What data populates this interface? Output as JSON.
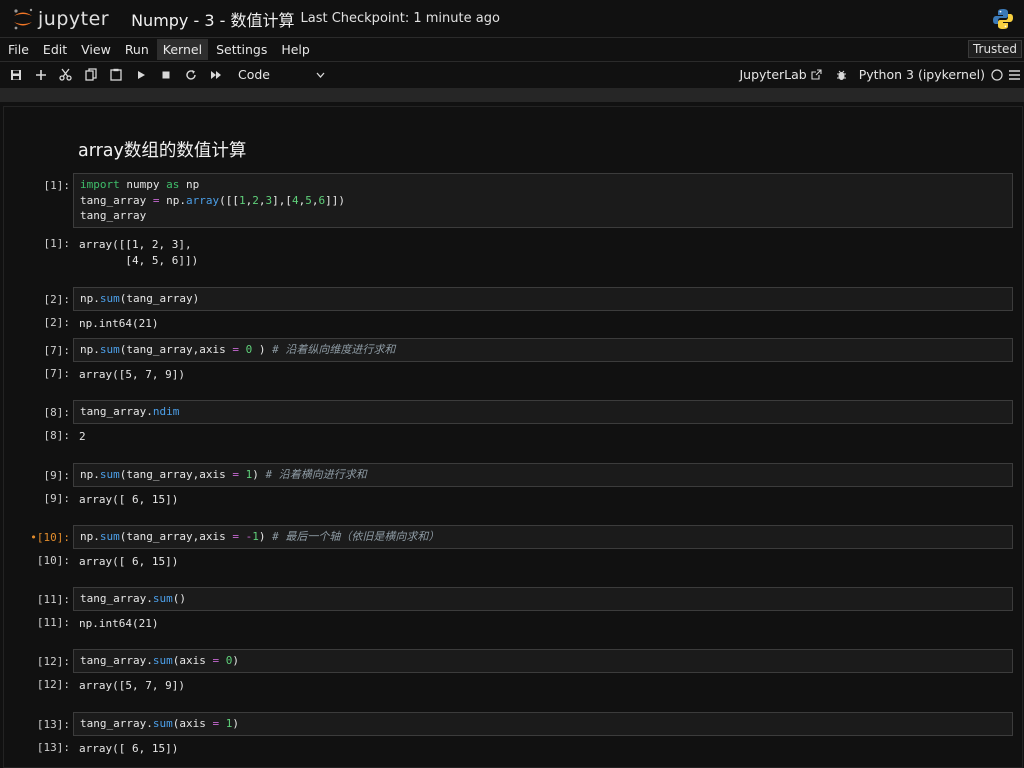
{
  "header": {
    "logo_text": "jupyter",
    "notebook_title": "Numpy - 3 - 数值计算",
    "checkpoint": "Last Checkpoint: 1 minute ago"
  },
  "menu": {
    "items": [
      "File",
      "Edit",
      "View",
      "Run",
      "Kernel",
      "Settings",
      "Help"
    ],
    "active": "Kernel",
    "trusted": "Trusted"
  },
  "toolbar": {
    "cell_type": "Code",
    "jupyterlab_link": "JupyterLab",
    "kernel_name": "Python 3 (ipykernel)"
  },
  "notebook": {
    "heading": "array数组的数值计算",
    "cells": [
      {
        "in_prompt": "[1]:",
        "out_prompt": "[1]:",
        "lines": [
          [
            [
              "kw",
              "import"
            ],
            [
              "pl",
              " numpy "
            ],
            [
              "kw",
              "as"
            ],
            [
              "pl",
              " np"
            ]
          ],
          [
            [
              "pl",
              "tang_array "
            ],
            [
              "op",
              "="
            ],
            [
              "pl",
              " np."
            ],
            [
              "fn",
              "array"
            ],
            [
              "pl",
              "([["
            ],
            [
              "num",
              "1"
            ],
            [
              "pl",
              ","
            ],
            [
              "num",
              "2"
            ],
            [
              "pl",
              ","
            ],
            [
              "num",
              "3"
            ],
            [
              "pl",
              "],["
            ],
            [
              "num",
              "4"
            ],
            [
              "pl",
              ","
            ],
            [
              "num",
              "5"
            ],
            [
              "pl",
              ","
            ],
            [
              "num",
              "6"
            ],
            [
              "pl",
              "]])"
            ]
          ],
          [
            [
              "pl",
              "tang_array"
            ]
          ]
        ],
        "output": "array([[1, 2, 3],\n       [4, 5, 6]])"
      },
      {
        "in_prompt": "[2]:",
        "out_prompt": "[2]:",
        "lines": [
          [
            [
              "pl",
              "np."
            ],
            [
              "fn",
              "sum"
            ],
            [
              "pl",
              "(tang_array)"
            ]
          ]
        ],
        "output": "np.int64(21)"
      },
      {
        "in_prompt": "[7]:",
        "out_prompt": "[7]:",
        "lines": [
          [
            [
              "pl",
              "np."
            ],
            [
              "fn",
              "sum"
            ],
            [
              "pl",
              "(tang_array,axis "
            ],
            [
              "op",
              "="
            ],
            [
              "pl",
              " "
            ],
            [
              "num",
              "0"
            ],
            [
              "pl",
              " ) "
            ],
            [
              "cm",
              "# 沿着纵向维度进行求和"
            ]
          ]
        ],
        "output": "array([5, 7, 9])"
      },
      {
        "in_prompt": "[8]:",
        "out_prompt": "[8]:",
        "lines": [
          [
            [
              "pl",
              "tang_array."
            ],
            [
              "fn",
              "ndim"
            ]
          ]
        ],
        "output": "2"
      },
      {
        "in_prompt": "[9]:",
        "out_prompt": "[9]:",
        "lines": [
          [
            [
              "pl",
              "np."
            ],
            [
              "fn",
              "sum"
            ],
            [
              "pl",
              "(tang_array,axis "
            ],
            [
              "op",
              "="
            ],
            [
              "pl",
              " "
            ],
            [
              "num",
              "1"
            ],
            [
              "pl",
              ") "
            ],
            [
              "cm",
              "# 沿着横向进行求和"
            ]
          ]
        ],
        "output": "array([ 6, 15])"
      },
      {
        "in_prompt": "•[10]:",
        "dirty": true,
        "out_prompt": "[10]:",
        "lines": [
          [
            [
              "pl",
              "np."
            ],
            [
              "fn",
              "sum"
            ],
            [
              "pl",
              "(tang_array,axis "
            ],
            [
              "op",
              "="
            ],
            [
              "pl",
              " "
            ],
            [
              "op",
              "-"
            ],
            [
              "num",
              "1"
            ],
            [
              "pl",
              ") "
            ],
            [
              "cm",
              "# 最后一个轴（依旧是横向求和）"
            ]
          ]
        ],
        "output": "array([ 6, 15])"
      },
      {
        "in_prompt": "[11]:",
        "out_prompt": "[11]:",
        "lines": [
          [
            [
              "pl",
              "tang_array."
            ],
            [
              "fn",
              "sum"
            ],
            [
              "pl",
              "()"
            ]
          ]
        ],
        "output": "np.int64(21)"
      },
      {
        "in_prompt": "[12]:",
        "out_prompt": "[12]:",
        "lines": [
          [
            [
              "pl",
              "tang_array."
            ],
            [
              "fn",
              "sum"
            ],
            [
              "pl",
              "(axis "
            ],
            [
              "op",
              "="
            ],
            [
              "pl",
              " "
            ],
            [
              "num",
              "0"
            ],
            [
              "pl",
              ")"
            ]
          ]
        ],
        "output": "array([5, 7, 9])"
      },
      {
        "in_prompt": "[13]:",
        "out_prompt": "[13]:",
        "lines": [
          [
            [
              "pl",
              "tang_array."
            ],
            [
              "fn",
              "sum"
            ],
            [
              "pl",
              "(axis "
            ],
            [
              "op",
              "="
            ],
            [
              "pl",
              " "
            ],
            [
              "num",
              "1"
            ],
            [
              "pl",
              ")"
            ]
          ]
        ],
        "output": "array([ 6, 15])"
      }
    ]
  }
}
